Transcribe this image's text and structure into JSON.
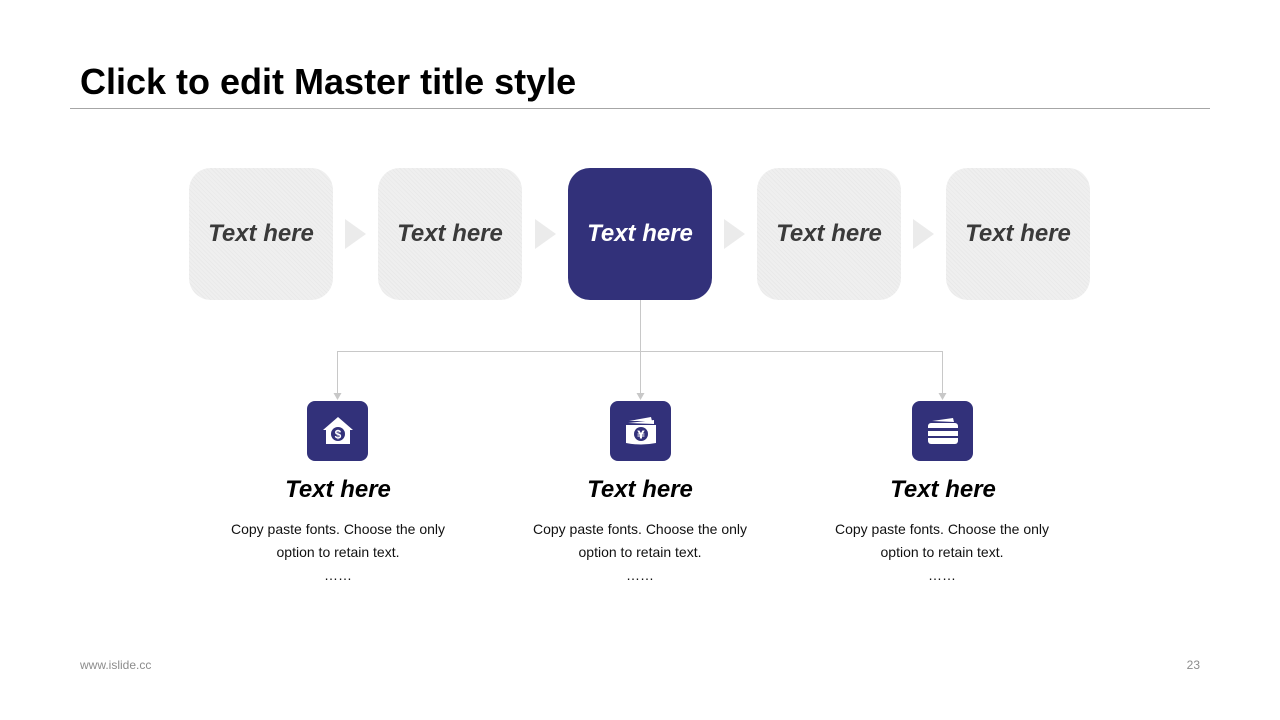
{
  "slide": {
    "title": "Click to edit Master title style",
    "footer_url": "www.islide.cc",
    "page_number": "23"
  },
  "colors": {
    "accent": "#32317a",
    "step_inactive": "#efefef",
    "chevron": "#ebebeb",
    "connector": "#c8c8c8"
  },
  "steps": [
    {
      "label": "Text here",
      "active": false
    },
    {
      "label": "Text here",
      "active": false
    },
    {
      "label": "Text here",
      "active": true
    },
    {
      "label": "Text here",
      "active": false
    },
    {
      "label": "Text here",
      "active": false
    }
  ],
  "features": [
    {
      "icon": "house-dollar-icon",
      "title": "Text here",
      "desc_line1": "Copy paste fonts. Choose the only",
      "desc_line2": "option to retain text.",
      "ellipsis": "……"
    },
    {
      "icon": "yen-wallet-icon",
      "title": "Text here",
      "desc_line1": "Copy paste fonts. Choose the only",
      "desc_line2": "option to retain text.",
      "ellipsis": "……"
    },
    {
      "icon": "credit-card-icon",
      "title": "Text here",
      "desc_line1": "Copy paste fonts. Choose the only",
      "desc_line2": "option to retain text.",
      "ellipsis": "……"
    }
  ]
}
